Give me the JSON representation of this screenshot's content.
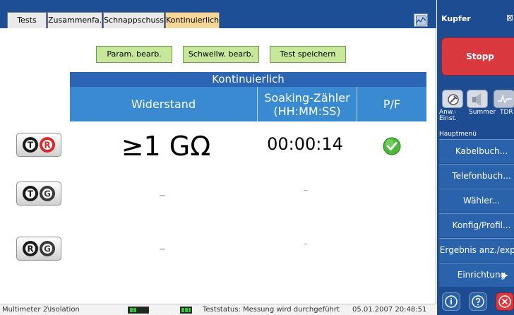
{
  "tabs": [
    {
      "label": "Tests"
    },
    {
      "label": "Zusammenfa."
    },
    {
      "label": "Schnappschuss"
    },
    {
      "label": "Kontinuierlich"
    }
  ],
  "actions": {
    "param_label": "Param. bearb.",
    "schwell_label": "Schwellw. bearb.",
    "save_label": "Test speichern"
  },
  "table": {
    "title": "Kontinuierlich",
    "col_widerstand": "Widerstand",
    "col_soaking_line1": "Soaking-Zähler",
    "col_soaking_line2": "(HH:MM:SS)",
    "col_pf": "P/F",
    "rows": [
      {
        "pair": [
          "T",
          "R"
        ],
        "widerstand": "≥1 GΩ",
        "soaking": "00:00:14",
        "pf": "pass"
      },
      {
        "pair": [
          "T",
          "G"
        ],
        "widerstand": "–",
        "soaking": "–",
        "pf": ""
      },
      {
        "pair": [
          "R",
          "G"
        ],
        "widerstand": "–",
        "soaking": "–",
        "pf": ""
      }
    ]
  },
  "status": {
    "path": "Multimeter 2\\Isolation",
    "teststatus": "Teststatus: Messung wird durchgeführt",
    "datetime": "05.01.2007 20:48:51"
  },
  "side": {
    "title": "Kupfer",
    "more": "⊠",
    "stop_label": "Stopp",
    "tools": [
      {
        "label": "Anw.- Einst.",
        "icon": "wrench-settings-icon"
      },
      {
        "label": "Summer",
        "icon": "speaker-icon"
      },
      {
        "label": "TDR",
        "icon": "tdr-wave-icon"
      }
    ],
    "menu_head": "Hauptmenü",
    "menu": [
      {
        "label": "Kabelbuch..."
      },
      {
        "label": "Telefonbuch..."
      },
      {
        "label": "Wähler..."
      },
      {
        "label": "Konfig/Profil..."
      },
      {
        "label": "Ergebnis anz./exp..."
      },
      {
        "label": "Einrichtung"
      }
    ],
    "menu_arrow": "▶"
  },
  "colors": {
    "header_blue": "#1d4f96",
    "table_title": "#2b65b4",
    "table_header": "#3a8ad2",
    "action_green": "#c7e89a",
    "active_tab": "#f6d79a",
    "stop_red": "#d9383f",
    "pass_green": "#4eb83c"
  }
}
